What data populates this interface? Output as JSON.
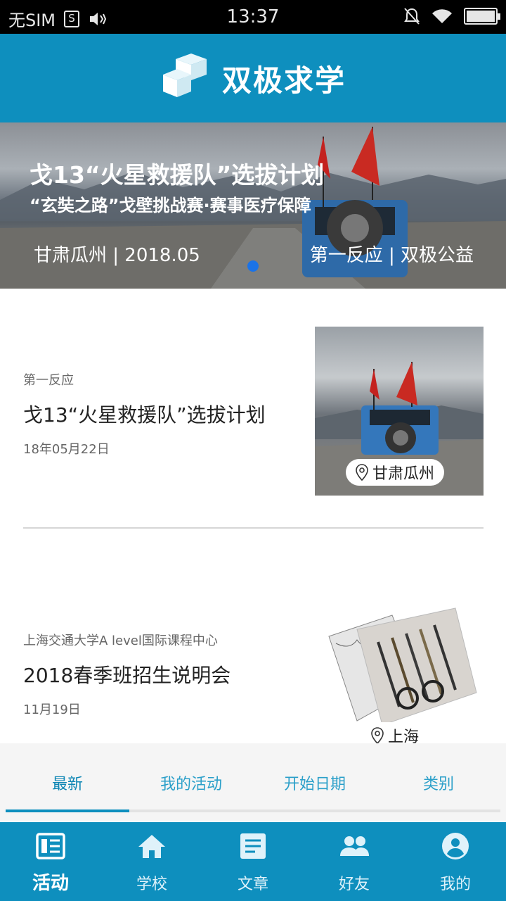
{
  "status_bar": {
    "carrier": "无SIM",
    "sim_badge": "S",
    "time": "13:37"
  },
  "header": {
    "app_title": "双极求学",
    "brand_color": "#0e8fbe"
  },
  "banner": {
    "title": "戈13“火星救援队”选拔计划",
    "subtitle": "“玄奘之路”戈壁挑战赛·赛事医疗保障",
    "place_date": "甘肃瓜州 | 2018.05",
    "org": "第一反应 | 双极公益"
  },
  "feed": [
    {
      "source": "第一反应",
      "title": "戈13“火星救援队”选拔计划",
      "date": "18年05月22日",
      "location": "甘肃瓜州"
    },
    {
      "source": "上海交通大学A level国际课程中心",
      "title": "2018春季班招生说明会",
      "date": "11月19日",
      "location": "上海"
    }
  ],
  "tabs": [
    {
      "label": "最新",
      "active": true
    },
    {
      "label": "我的活动",
      "active": false
    },
    {
      "label": "开始日期",
      "active": false
    },
    {
      "label": "类别",
      "active": false
    }
  ],
  "bottom_nav": [
    {
      "label": "活动",
      "icon": "newspaper-icon",
      "active": true
    },
    {
      "label": "学校",
      "icon": "home-icon",
      "active": false
    },
    {
      "label": "文章",
      "icon": "article-icon",
      "active": false
    },
    {
      "label": "好友",
      "icon": "people-icon",
      "active": false
    },
    {
      "label": "我的",
      "icon": "account-icon",
      "active": false
    }
  ]
}
